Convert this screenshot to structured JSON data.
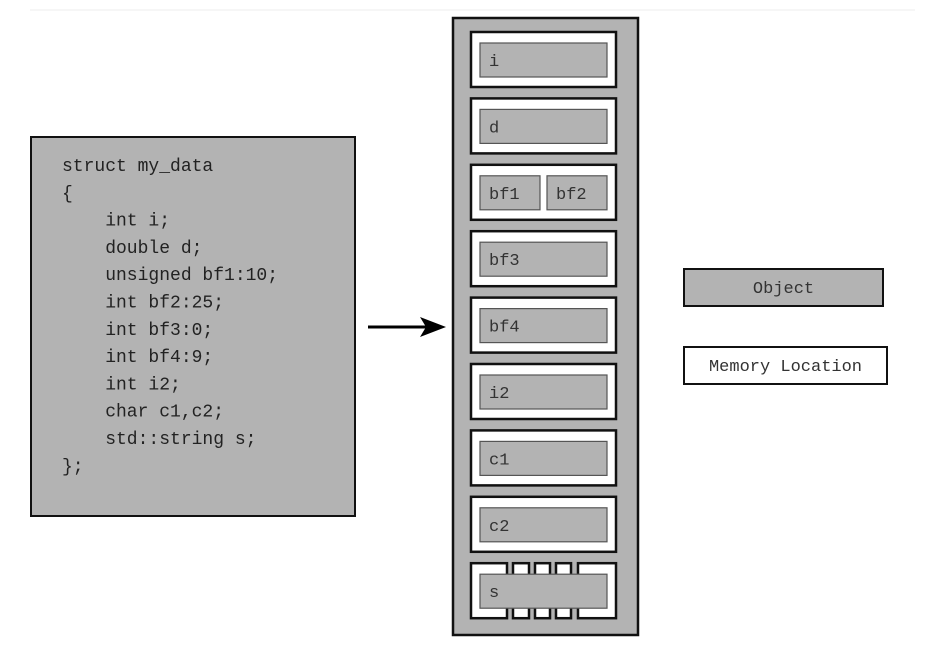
{
  "colors": {
    "object_fill": "#b3b3b3",
    "memory_location_fill": "#ffffff",
    "outline": "#111111"
  },
  "code": {
    "lines": [
      "struct my_data",
      "{",
      "    int i;",
      "    double d;",
      "    unsigned bf1:10;",
      "    int bf2:25;",
      "    int bf3:0;",
      "    int bf4:9;",
      "    int i2;",
      "    char c1,c2;",
      "    std::string s;",
      "};"
    ]
  },
  "memory": {
    "rows": [
      {
        "objects": [
          "i"
        ]
      },
      {
        "objects": [
          "d"
        ]
      },
      {
        "objects": [
          "bf1",
          "bf2"
        ]
      },
      {
        "objects": [
          "bf3"
        ]
      },
      {
        "objects": [
          "bf4"
        ]
      },
      {
        "objects": [
          "i2"
        ]
      },
      {
        "objects": [
          "c1"
        ]
      },
      {
        "objects": [
          "c2"
        ]
      },
      {
        "objects": [
          "s"
        ],
        "multiple_locations": true
      }
    ]
  },
  "legend": {
    "object_label": "Object",
    "memory_location_label": "Memory Location"
  }
}
